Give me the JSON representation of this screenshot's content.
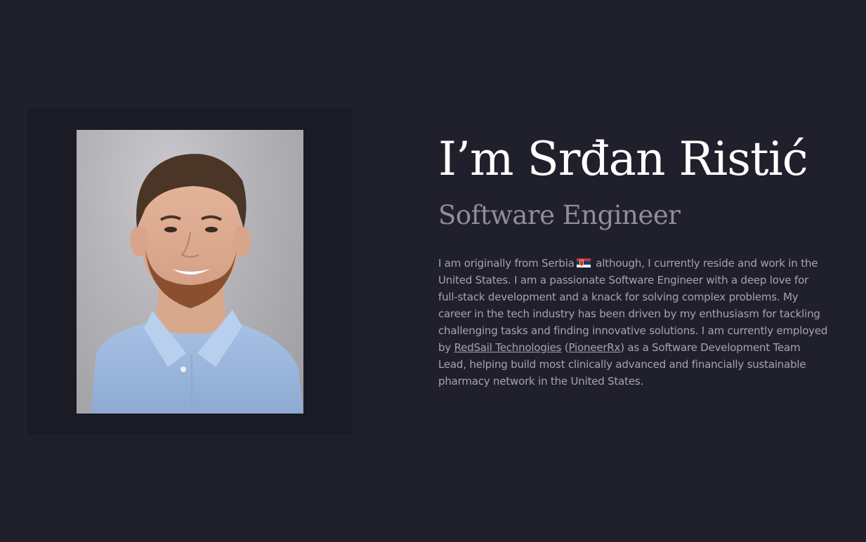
{
  "profile": {
    "name_heading": "I’m Srđan Ristić",
    "role": "Software Engineer",
    "photo_alt": "Portrait of Srđan Ristić",
    "flag_icon": "serbia-flag-icon",
    "bio": {
      "part1": "I am originally from Serbia",
      "part2": "although, I currently reside and work in the United States. I am a passionate Software Engineer with a deep love for full-stack development and a knack for solving complex problems. My career in the tech industry has been driven by my enthusiasm for tackling challenging tasks and finding innovative solutions. I am currently employed by",
      "company_link": "RedSail Technologies",
      "paren_open": "(",
      "product_link": "PioneerRx",
      "part3": ") as a Software Development Team Lead, helping build most clinically advanced and financially sustainable pharmacy network in the United States."
    }
  },
  "colors": {
    "background": "#20202c",
    "photo_frame": "#1b1b25",
    "heading": "#ffffff",
    "subheading": "#8f8e98",
    "body_text": "#a5a4ad"
  }
}
